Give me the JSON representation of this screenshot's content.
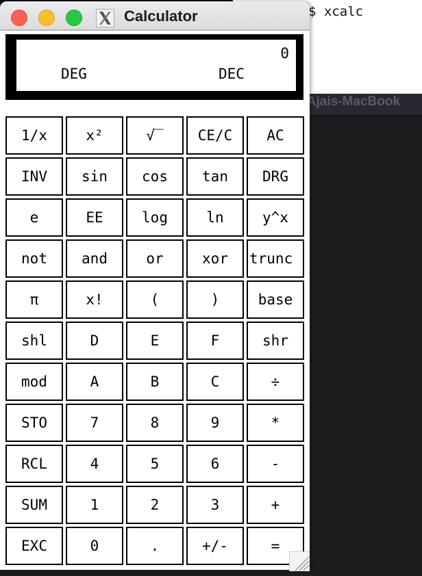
{
  "terminal": {
    "prompt_text": "$ xcalc",
    "titlebar_text": "l@Ajais-MacBook"
  },
  "window": {
    "title": "Calculator",
    "app_icon": "x11-icon",
    "controls": [
      "close",
      "minimize",
      "maximize"
    ]
  },
  "display": {
    "value": "0",
    "angle_mode": "DEG",
    "base_mode": "DEC"
  },
  "keys": [
    [
      "1/x",
      "x²",
      "√‾",
      "CE/C",
      "AC"
    ],
    [
      "INV",
      "sin",
      "cos",
      "tan",
      "DRG"
    ],
    [
      "e",
      "EE",
      "log",
      "ln",
      "y^x"
    ],
    [
      "not",
      "and",
      "or",
      "xor",
      "trunc"
    ],
    [
      "π",
      "x!",
      "(",
      ")",
      "base"
    ],
    [
      "shl",
      "D",
      "E",
      "F",
      "shr"
    ],
    [
      "mod",
      "A",
      "B",
      "C",
      "÷"
    ],
    [
      "STO",
      "7",
      "8",
      "9",
      "*"
    ],
    [
      "RCL",
      "4",
      "5",
      "6",
      "-"
    ],
    [
      "SUM",
      "1",
      "2",
      "3",
      "+"
    ],
    [
      "EXC",
      "0",
      ".",
      "+/-",
      "="
    ]
  ]
}
